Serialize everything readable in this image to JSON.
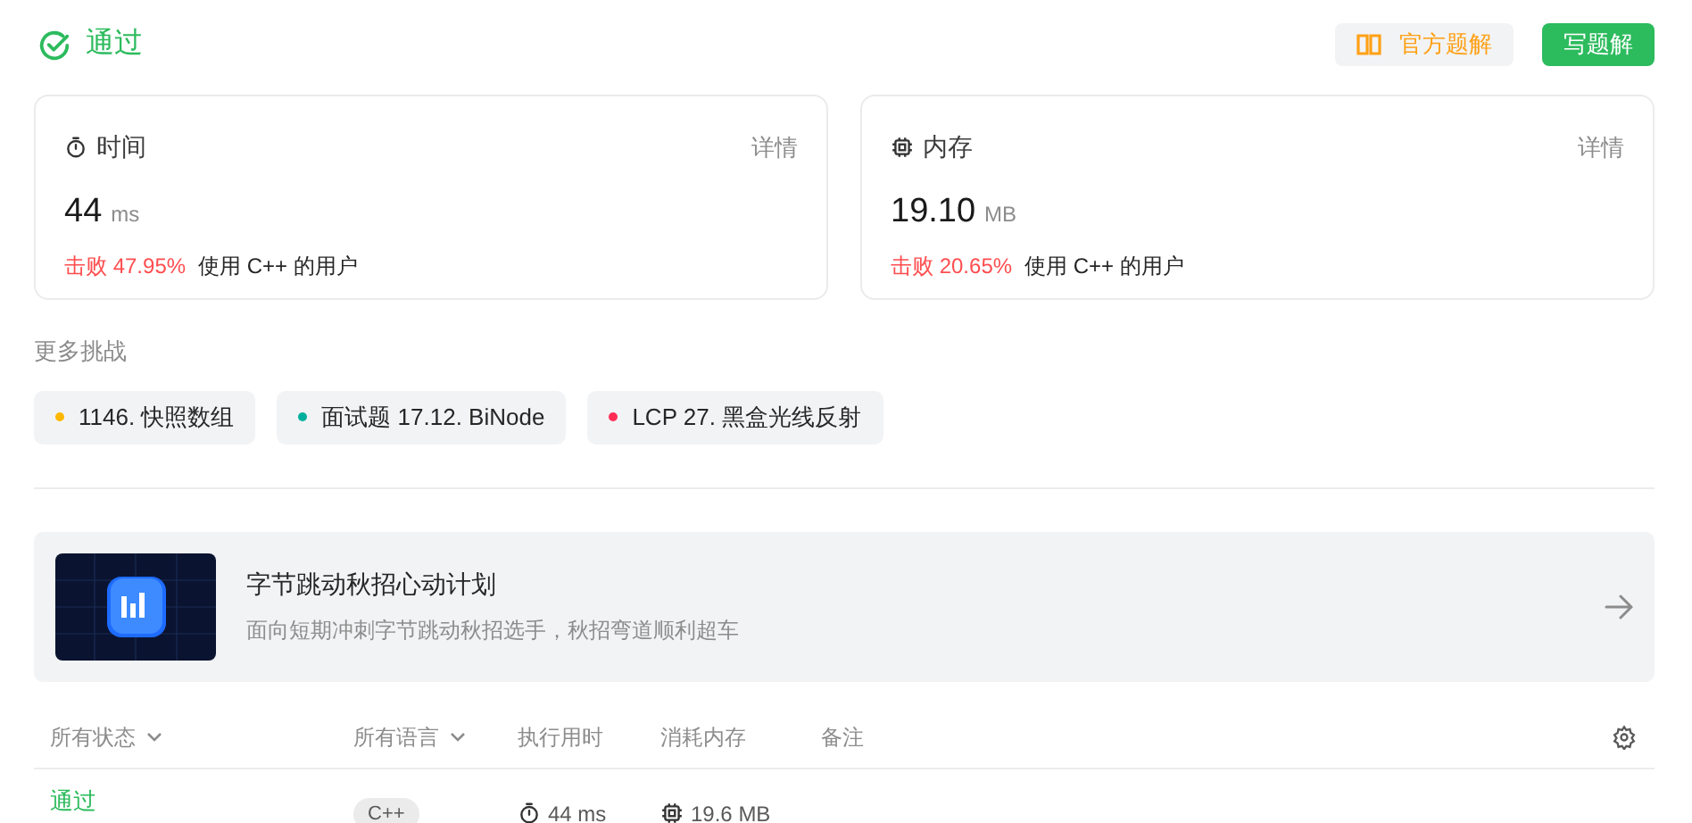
{
  "status": {
    "label": "通过"
  },
  "actions": [
    {
      "label": "官方题解",
      "kind": "secondary"
    },
    {
      "label": "写题解",
      "kind": "primary"
    }
  ],
  "metrics": [
    {
      "kind": "time",
      "title": "时间",
      "details": "详情",
      "value": "44",
      "unit": "ms",
      "beat": "击败 47.95%",
      "note": "使用 C++ 的用户"
    },
    {
      "kind": "memory",
      "title": "内存",
      "details": "详情",
      "value": "19.10",
      "unit": "MB",
      "beat": "击败 20.65%",
      "note": "使用 C++ 的用户"
    }
  ],
  "more_challenges": {
    "title": "更多挑战",
    "items": [
      {
        "label": "1146. 快照数组",
        "color": "#ffb800"
      },
      {
        "label": "面试题 17.12. BiNode",
        "color": "#00af9b"
      },
      {
        "label": "LCP 27. 黑盒光线反射",
        "color": "#ff2d55"
      }
    ]
  },
  "banner": {
    "title": "字节跳动秋招心动计划",
    "subtitle": "面向短期冲刺字节跳动秋招选手，秋招弯道顺利超车"
  },
  "table": {
    "columns": [
      {
        "label": "所有状态",
        "dropdown": true
      },
      {
        "label": "所有语言",
        "dropdown": true
      },
      {
        "label": "执行用时",
        "dropdown": false
      },
      {
        "label": "消耗内存",
        "dropdown": false
      },
      {
        "label": "备注",
        "dropdown": false
      }
    ],
    "rows": [
      {
        "status": "通过",
        "language": "C++",
        "time": "44 ms",
        "memory": "19.6 MB"
      }
    ]
  }
}
